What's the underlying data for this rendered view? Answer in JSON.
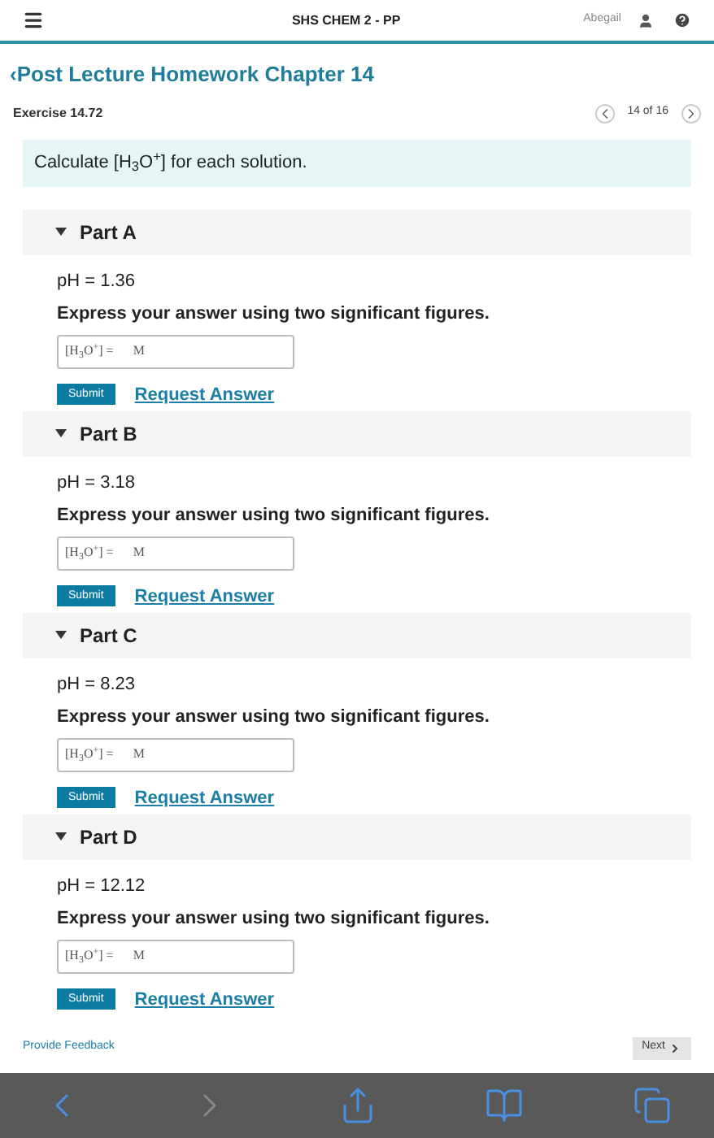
{
  "header": {
    "title": "SHS CHEM 2 - PP",
    "user": "Abegail"
  },
  "back_link": "‹Post Lecture Homework Chapter 14",
  "exercise": {
    "title": "Exercise 14.72",
    "position": "14 of 16"
  },
  "prompt": "Calculate [H$_{3}$O$^{+}$] for each solution.",
  "parts": [
    {
      "title": "Part A",
      "expanded": true,
      "given": "pH = 1.36",
      "instruction": "Express your answer using two significant figures.",
      "field_label": "[H$_{3}$O$^{+}$] =",
      "unit": "M",
      "submit": "Submit",
      "request": "Request Answer"
    },
    {
      "title": "Part B",
      "expanded": true,
      "given": "pH = 3.18",
      "instruction": "Express your answer using two significant figures.",
      "field_label": "[H$_{3}$O$^{+}$] =",
      "unit": "M",
      "submit": "Submit",
      "request": "Request Answer"
    },
    {
      "title": "Part C",
      "expanded": true,
      "given": "pH = 8.23",
      "instruction": "Express your answer using two significant figures.",
      "field_label": "[H$_{3}$O$^{+}$] =",
      "unit": "M",
      "submit": "Submit",
      "request": "Request Answer"
    },
    {
      "title": "Part D",
      "expanded": true,
      "given": "pH = 12.12",
      "instruction": "Express your answer using two significant figures.",
      "field_label": "[H$_{3}$O$^{+}$] =",
      "unit": "M",
      "submit": "Submit",
      "request": "Request Answer"
    }
  ],
  "footer": {
    "feedback": "Provide Feedback",
    "next": "Next"
  },
  "toolbar": [
    {
      "kind": "back",
      "disabled": false
    },
    {
      "kind": "forward",
      "disabled": true
    },
    {
      "kind": "share",
      "disabled": false
    },
    {
      "kind": "bookmarks",
      "disabled": false
    },
    {
      "kind": "tabs",
      "disabled": false
    }
  ]
}
